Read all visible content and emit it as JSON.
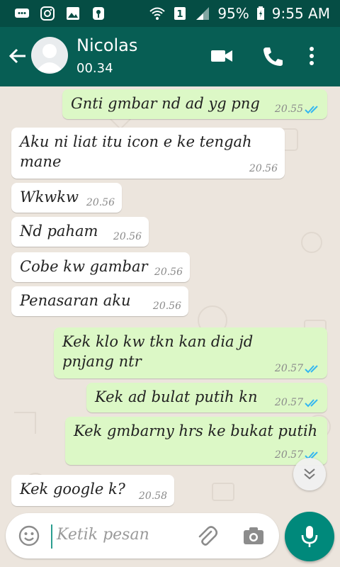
{
  "statusbar": {
    "battery": "95%",
    "time": "9:55 AM"
  },
  "header": {
    "name": "Nicolas",
    "status": "00.34"
  },
  "messages": [
    {
      "dir": "out",
      "text": "Gnti gmbar nd ad yg png",
      "time": "20.55"
    },
    {
      "dir": "in",
      "text": "Aku ni liat itu icon e ke tengah",
      "text2": "mane",
      "time": "20.56"
    },
    {
      "dir": "in",
      "text": "Wkwkw",
      "time": "20.56"
    },
    {
      "dir": "in",
      "text": "Nd paham",
      "time": "20.56"
    },
    {
      "dir": "in",
      "text": "Cobe kw gambar",
      "time": "20.56"
    },
    {
      "dir": "in",
      "text": "Penasaran aku",
      "time": "20.56"
    },
    {
      "dir": "out",
      "text": "Kek klo kw tkn kan dia jd",
      "text2": "pnjang ntr",
      "time": "20.57"
    },
    {
      "dir": "out",
      "text": "Kek ad bulat putih kn",
      "time": "20.57"
    },
    {
      "dir": "out",
      "text": "Kek gmbarny hrs ke bukat putih",
      "time": "20.57"
    },
    {
      "dir": "in",
      "text": "Kek google k?",
      "time": "20.58"
    }
  ],
  "composer": {
    "placeholder": "Ketik pesan"
  },
  "colors": {
    "header": "#075e54",
    "statusbar": "#054d44",
    "outgoing": "#dcf8c6",
    "incoming": "#ffffff",
    "fab": "#00897b",
    "read_ticks": "#34b7f1"
  }
}
